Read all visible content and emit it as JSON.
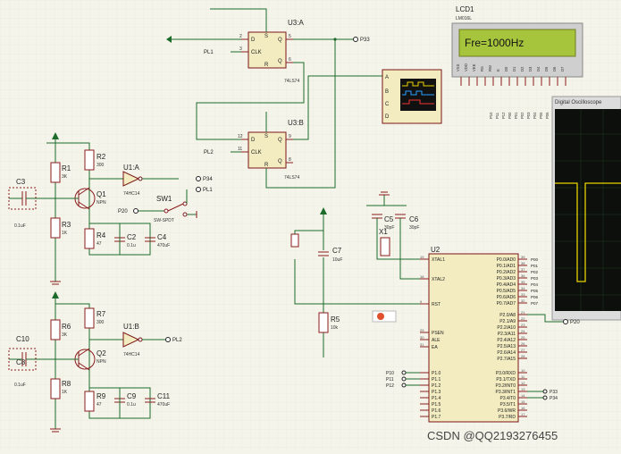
{
  "lcd": {
    "ref": "LCD1",
    "model": "LM016L",
    "display": "Fre=1000Hz",
    "pins": [
      "VSS",
      "VDD",
      "VEE",
      "RS",
      "RW",
      "E",
      "D0",
      "D1",
      "D2",
      "D3",
      "D4",
      "D5",
      "D6",
      "D7"
    ]
  },
  "scope_window": {
    "title": "Digital Oscilloscope"
  },
  "scope_icon": {
    "channels": [
      "A",
      "B",
      "C",
      "D"
    ]
  },
  "u3a": {
    "ref": "U3:A",
    "part": "74LS74",
    "pins": [
      "D",
      "CLK",
      "Q",
      "Q",
      "S",
      "R"
    ],
    "net_in": "PL1",
    "net_out": "P33"
  },
  "u3b": {
    "ref": "U3:B",
    "part": "74LS74",
    "pins": [
      "D",
      "CLK",
      "Q",
      "Q",
      "S",
      "R"
    ],
    "net_in": "PL2"
  },
  "u1a": {
    "ref": "U1:A",
    "part": "74HC14"
  },
  "u1b": {
    "ref": "U1:B",
    "part": "74HC14"
  },
  "q1": {
    "ref": "Q1",
    "type": "NPN"
  },
  "q2": {
    "ref": "Q2",
    "type": "NPN"
  },
  "sw1": {
    "ref": "SW1",
    "type": "SW-SPDT"
  },
  "upper_stage": {
    "r1": {
      "ref": "R1",
      "value": "3K"
    },
    "r2": {
      "ref": "R2",
      "value": "300"
    },
    "r3": {
      "ref": "R3",
      "value": "1K"
    },
    "r4": {
      "ref": "R4",
      "value": "47"
    },
    "c2": {
      "ref": "C2",
      "value": "0.1u"
    },
    "c3": {
      "ref": "C3",
      "value": "0.1uF"
    },
    "c4": {
      "ref": "C4",
      "value": "470uF"
    }
  },
  "lower_stage": {
    "r6": {
      "ref": "R6",
      "value": "3K"
    },
    "r7": {
      "ref": "R7",
      "value": "300"
    },
    "r8": {
      "ref": "R8",
      "value": "1K"
    },
    "r9": {
      "ref": "R9",
      "value": "47"
    },
    "c8": {
      "ref": "C8",
      "value": "0.1uF"
    },
    "c9": {
      "ref": "C9",
      "value": "0.1u"
    },
    "c10": {
      "ref": "C10",
      "value": ""
    },
    "c11": {
      "ref": "C11",
      "value": "470uF"
    }
  },
  "nets": {
    "p34": "P34",
    "pl1": "PL1",
    "p20": "P20",
    "pl2": "PL2",
    "p33": "P33"
  },
  "xtal": {
    "c5": {
      "ref": "C5",
      "value": "30pF"
    },
    "c6": {
      "ref": "C6",
      "value": "30pF"
    },
    "x1": "X1"
  },
  "reset": {
    "c7": {
      "ref": "C7",
      "value": "10uF"
    },
    "r5": {
      "ref": "R5",
      "value": "10k"
    }
  },
  "u2": {
    "ref": "U2",
    "left_pins": [
      {
        "no": "19",
        "name": "XTAL1"
      },
      {
        "no": "18",
        "name": "XTAL2"
      },
      {
        "no": "9",
        "name": "RST"
      },
      {
        "no": "29",
        "name": "PSEN"
      },
      {
        "no": "30",
        "name": "ALE"
      },
      {
        "no": "31",
        "name": "EA"
      }
    ],
    "p1_pins": [
      "P1.0",
      "P1.1",
      "P1.2",
      "P1.3",
      "P1.4",
      "P1.5",
      "P1.6",
      "P1.7"
    ],
    "p0_pins": [
      {
        "no": "39",
        "name": "P0.0/AD0"
      },
      {
        "no": "38",
        "name": "P0.1/AD1"
      },
      {
        "no": "37",
        "name": "P0.2/AD2"
      },
      {
        "no": "36",
        "name": "P0.3/AD3"
      },
      {
        "no": "35",
        "name": "P0.4/AD4"
      },
      {
        "no": "34",
        "name": "P0.5/AD5"
      },
      {
        "no": "33",
        "name": "P0.6/AD6"
      },
      {
        "no": "32",
        "name": "P0.7/AD7"
      }
    ],
    "p2_pins": [
      {
        "no": "21",
        "name": "P2.0/A8"
      },
      {
        "no": "22",
        "name": "P2.1/A9"
      },
      {
        "no": "23",
        "name": "P2.2/A10"
      },
      {
        "no": "24",
        "name": "P2.3/A11"
      },
      {
        "no": "25",
        "name": "P2.4/A12"
      },
      {
        "no": "26",
        "name": "P2.5/A13"
      },
      {
        "no": "27",
        "name": "P2.6/A14"
      },
      {
        "no": "28",
        "name": "P2.7/A15"
      }
    ],
    "p3_pins": [
      {
        "no": "10",
        "name": "P3.0/RXD"
      },
      {
        "no": "11",
        "name": "P3.1/TXD"
      },
      {
        "no": "12",
        "name": "P3.2/INT0"
      },
      {
        "no": "13",
        "name": "P3.3/INT1"
      },
      {
        "no": "14",
        "name": "P3.4/T0"
      },
      {
        "no": "15",
        "name": "P3.5/T1"
      },
      {
        "no": "16",
        "name": "P3.6/WR"
      },
      {
        "no": "17",
        "name": "P3.7/RD"
      }
    ],
    "port_labels_left": [
      "P10",
      "P11",
      "P12"
    ],
    "port_labels_right": [
      "P33",
      "P34"
    ],
    "p0_labels": [
      "P00",
      "P01",
      "P02",
      "P03",
      "P04",
      "P05",
      "P06",
      "P07"
    ]
  },
  "lcd_net_labels": [
    "P10",
    "P11",
    "P12",
    "P00",
    "P01",
    "P02",
    "P03",
    "P04",
    "P05",
    "P06",
    "P07"
  ],
  "watermark": "CSDN @QQ2193276455"
}
